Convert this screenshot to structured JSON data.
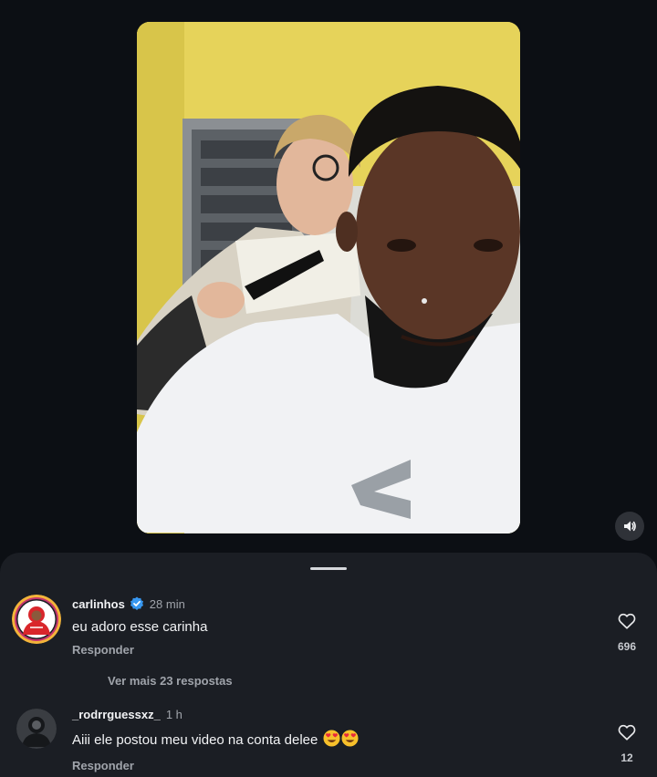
{
  "video": {
    "mute_icon": "speaker-icon",
    "colors": {
      "wall": "#e6d35a",
      "cape": "#f1f2f4"
    }
  },
  "comments": [
    {
      "username": "carlinhos",
      "verified": true,
      "time": "28 min",
      "text": "eu adoro esse carinha",
      "reply_label": "Responder",
      "likes": "696",
      "more_replies": "Ver mais 23 respostas"
    },
    {
      "username": "_rodrrguessxz_",
      "verified": false,
      "time": "1 h",
      "text": "Aiii ele postou meu video na conta delee",
      "emojis": [
        "heart-eyes-emoji",
        "heart-eyes-emoji"
      ],
      "reply_label": "Responder",
      "likes": "12"
    }
  ],
  "colors": {
    "background": "#0c0f14",
    "sheet": "#1b1e24",
    "verified_badge": "#3797f0",
    "secondary_text": "#a0a4ab"
  }
}
